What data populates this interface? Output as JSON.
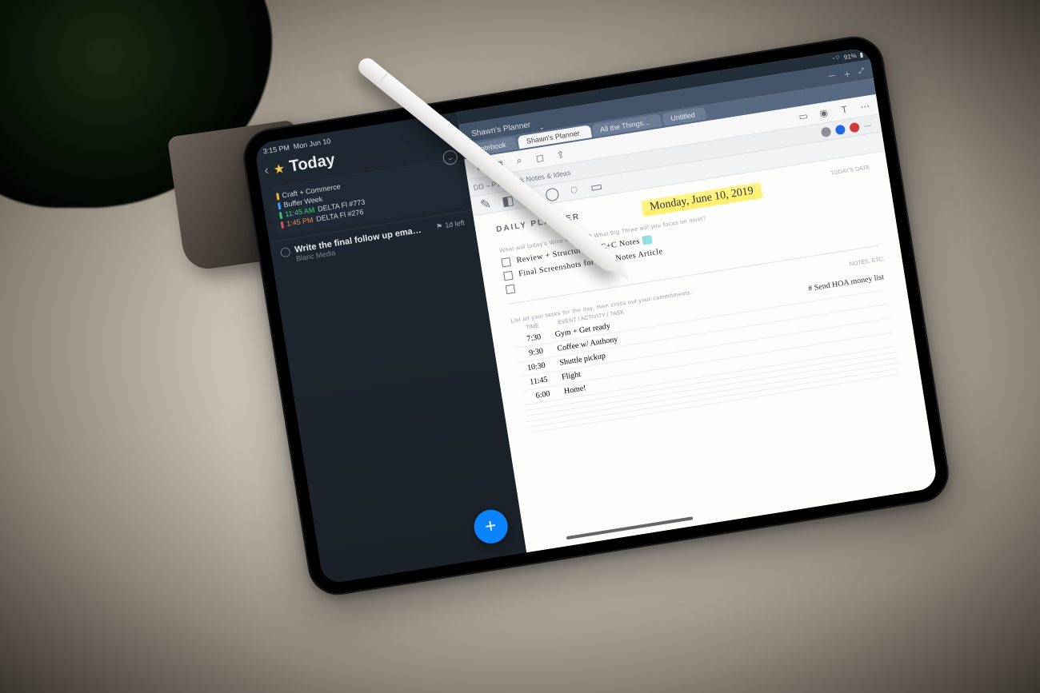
{
  "statusbar": {
    "time": "3:15 PM",
    "date": "Mon Jun 10",
    "battery": "91%"
  },
  "left_app": {
    "title": "Today",
    "card": {
      "line1": "Craft + Commerce",
      "line2": "Buffer Week",
      "line3_time": "11:45 AM",
      "line3_text": "DELTA Fl #773",
      "line4_time": "1:45 PM",
      "line4_text": "DELTA Fl #276"
    },
    "task": {
      "title": "Write the final follow up ema…",
      "subtitle": "Blanc Media",
      "badge": "1d left"
    },
    "fab": "+"
  },
  "notes_app": {
    "doc_title": "Shawn's Planner",
    "tabs": [
      "Notebook",
      "Shawn's Planner",
      "All the Things…",
      "Untitled"
    ],
    "subrow": {
      "left": "DD – PV",
      "label": "Quick Notes & Ideas"
    },
    "dots": [
      "#8c8f93",
      "#1f67e6",
      "#d23a3a"
    ],
    "page": {
      "title": "DAILY PLANNER",
      "date_label": "TODAY'S DATE",
      "hand_date": "Monday, June 10, 2019",
      "big3_label": "What will today's Wins look like? What Big Three will you focus on most?",
      "big3": [
        "Review + Structure  All  C+C  Notes",
        "Final Screenshots  for  GoodNotes  Article"
      ],
      "tasks_label": "List all your tasks for the day, then cross out your commitments.",
      "notes_label": "NOTES, ETC.",
      "side_note": "# Send  HOA  money  list",
      "sched_header": {
        "time": "TIME",
        "event": "EVENT / ACTIVITY / TASK"
      },
      "sched": [
        {
          "t": "7:30",
          "e": "Gym + Get ready"
        },
        {
          "t": "9:30",
          "e": "Coffee w/ Anthony"
        },
        {
          "t": "10:30",
          "e": "Shuttle pickup"
        },
        {
          "t": "11:45",
          "e": "Flight"
        },
        {
          "t": "6:00",
          "e": "Home!"
        }
      ]
    }
  }
}
